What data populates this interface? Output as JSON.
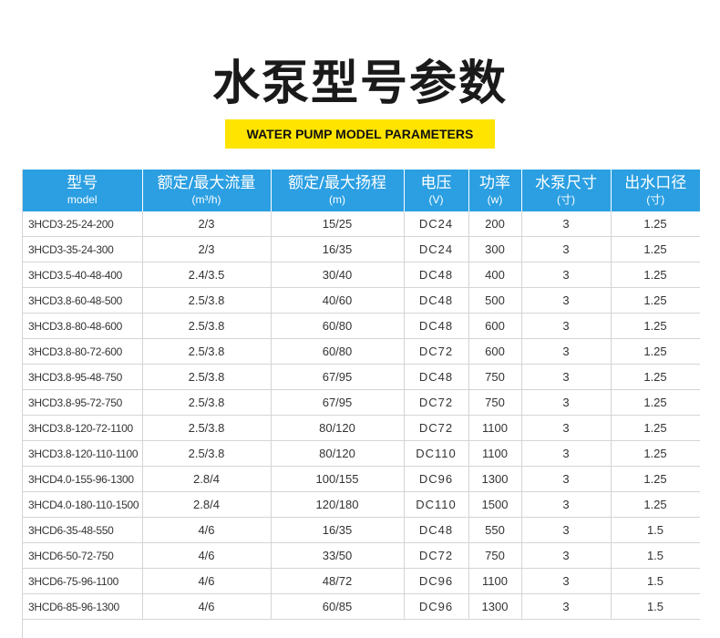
{
  "title": "水泵型号参数",
  "subtitle": "WATER PUMP MODEL PARAMETERS",
  "colors": {
    "header_bg": "#2b9fe2",
    "subtitle_bg": "#ffe400",
    "title_text": "#1a1a1a",
    "cell_text": "#333333"
  },
  "table": {
    "headers": [
      {
        "main": "型号",
        "sub": "model"
      },
      {
        "main": "额定/最大流量",
        "sub": "(m³/h)"
      },
      {
        "main": "额定/最大扬程",
        "sub": "(m)"
      },
      {
        "main": "电压",
        "sub": "(V)"
      },
      {
        "main": "功率",
        "sub": "(w)"
      },
      {
        "main": "水泵尺寸",
        "sub": "(寸)"
      },
      {
        "main": "出水口径",
        "sub": "(寸)"
      }
    ],
    "rows": [
      [
        "3HCD3-25-24-200",
        "2/3",
        "15/25",
        "DC24",
        "200",
        "3",
        "1.25"
      ],
      [
        "3HCD3-35-24-300",
        "2/3",
        "16/35",
        "DC24",
        "300",
        "3",
        "1.25"
      ],
      [
        "3HCD3.5-40-48-400",
        "2.4/3.5",
        "30/40",
        "DC48",
        "400",
        "3",
        "1.25"
      ],
      [
        "3HCD3.8-60-48-500",
        "2.5/3.8",
        "40/60",
        "DC48",
        "500",
        "3",
        "1.25"
      ],
      [
        "3HCD3.8-80-48-600",
        "2.5/3.8",
        "60/80",
        "DC48",
        "600",
        "3",
        "1.25"
      ],
      [
        "3HCD3.8-80-72-600",
        "2.5/3.8",
        "60/80",
        "DC72",
        "600",
        "3",
        "1.25"
      ],
      [
        "3HCD3.8-95-48-750",
        "2.5/3.8",
        "67/95",
        "DC48",
        "750",
        "3",
        "1.25"
      ],
      [
        "3HCD3.8-95-72-750",
        "2.5/3.8",
        "67/95",
        "DC72",
        "750",
        "3",
        "1.25"
      ],
      [
        "3HCD3.8-120-72-1100",
        "2.5/3.8",
        "80/120",
        "DC72",
        "1100",
        "3",
        "1.25"
      ],
      [
        "3HCD3.8-120-110-1100",
        "2.5/3.8",
        "80/120",
        "DC110",
        "1100",
        "3",
        "1.25"
      ],
      [
        "3HCD4.0-155-96-1300",
        "2.8/4",
        "100/155",
        "DC96",
        "1300",
        "3",
        "1.25"
      ],
      [
        "3HCD4.0-180-110-1500",
        "2.8/4",
        "120/180",
        "DC110",
        "1500",
        "3",
        "1.25"
      ],
      [
        "3HCD6-35-48-550",
        "4/6",
        "16/35",
        "DC48",
        "550",
        "3",
        "1.5"
      ],
      [
        "3HCD6-50-72-750",
        "4/6",
        "33/50",
        "DC72",
        "750",
        "3",
        "1.5"
      ],
      [
        "3HCD6-75-96-1100",
        "4/6",
        "48/72",
        "DC96",
        "1100",
        "3",
        "1.5"
      ],
      [
        "3HCD6-85-96-1300",
        "4/6",
        "60/85",
        "DC96",
        "1300",
        "3",
        "1.5"
      ]
    ]
  }
}
